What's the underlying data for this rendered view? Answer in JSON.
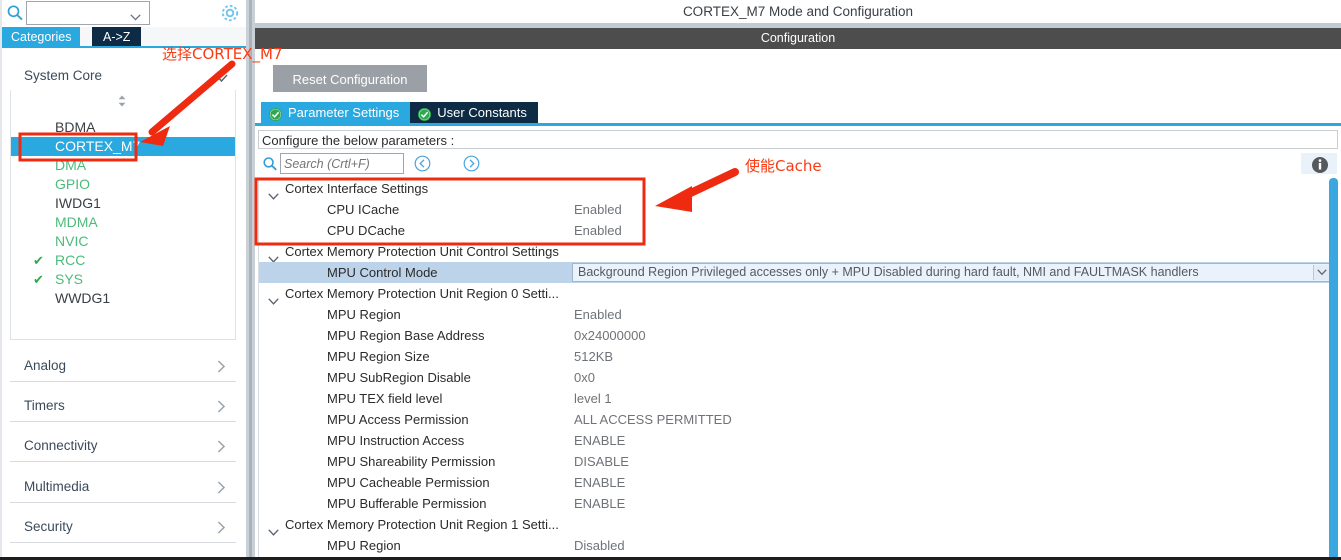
{
  "left": {
    "search": {
      "value": "",
      "placeholder": ""
    },
    "gear_icon": "gear-icon",
    "tabs": [
      {
        "id": "categories",
        "label": "Categories",
        "active": true
      },
      {
        "id": "a-to-z",
        "label": "A->Z",
        "active": false
      }
    ],
    "groups": [
      {
        "id": "system-core",
        "label": "System Core",
        "expanded": true
      },
      {
        "id": "analog",
        "label": "Analog",
        "expanded": false
      },
      {
        "id": "timers",
        "label": "Timers",
        "expanded": false
      },
      {
        "id": "connectivity",
        "label": "Connectivity",
        "expanded": false
      },
      {
        "id": "multimedia",
        "label": "Multimedia",
        "expanded": false
      },
      {
        "id": "security",
        "label": "Security",
        "expanded": false
      }
    ],
    "system_core_items": [
      {
        "label": "BDMA",
        "state": "dark",
        "check": false,
        "selected": false
      },
      {
        "label": "CORTEX_M7",
        "state": "sel",
        "check": false,
        "selected": true
      },
      {
        "label": "DMA",
        "state": "green",
        "check": false,
        "selected": false
      },
      {
        "label": "GPIO",
        "state": "green",
        "check": false,
        "selected": false
      },
      {
        "label": "IWDG1",
        "state": "dark",
        "check": false,
        "selected": false
      },
      {
        "label": "MDMA",
        "state": "green",
        "check": false,
        "selected": false
      },
      {
        "label": "NVIC",
        "state": "green",
        "check": false,
        "selected": false
      },
      {
        "label": "RCC",
        "state": "green",
        "check": true,
        "selected": false
      },
      {
        "label": "SYS",
        "state": "green",
        "check": true,
        "selected": false
      },
      {
        "label": "WWDG1",
        "state": "dark",
        "check": false,
        "selected": false
      }
    ]
  },
  "right": {
    "window_title": "CORTEX_M7 Mode and Configuration",
    "configuration_bar": "Configuration",
    "reset_button": "Reset Configuration",
    "tabs": [
      {
        "id": "parameter-settings",
        "label": "Parameter Settings",
        "active": true
      },
      {
        "id": "user-constants",
        "label": "User Constants",
        "active": false
      }
    ],
    "configure_note": "Configure the below parameters :",
    "search": {
      "value": "",
      "placeholder": "Search (Crtl+F)"
    },
    "nav_prev_icon": "circle-left-arrow-icon",
    "nav_next_icon": "circle-right-arrow-icon",
    "info_icon": "info-icon",
    "rows": [
      {
        "type": "group",
        "name": "Cortex Interface Settings",
        "value": "",
        "selected": false
      },
      {
        "type": "param",
        "name": "CPU ICache",
        "value": "Enabled",
        "selected": false
      },
      {
        "type": "param",
        "name": "CPU DCache",
        "value": "Enabled",
        "selected": false
      },
      {
        "type": "group",
        "name": "Cortex Memory Protection Unit Control Settings",
        "value": "",
        "selected": false
      },
      {
        "type": "combo",
        "name": "MPU Control Mode",
        "value": "Background Region Privileged accesses only + MPU Disabled during hard fault, NMI and FAULTMASK handlers",
        "selected": true
      },
      {
        "type": "group",
        "name": "Cortex Memory Protection Unit Region 0 Setti...",
        "value": "",
        "selected": false
      },
      {
        "type": "param",
        "name": "MPU Region",
        "value": "Enabled",
        "selected": false
      },
      {
        "type": "param",
        "name": "MPU Region Base Address",
        "value": "0x24000000",
        "selected": false
      },
      {
        "type": "param",
        "name": "MPU Region Size",
        "value": "512KB",
        "selected": false
      },
      {
        "type": "param",
        "name": "MPU SubRegion Disable",
        "value": "0x0",
        "selected": false
      },
      {
        "type": "param",
        "name": "MPU TEX field level",
        "value": "level 1",
        "selected": false
      },
      {
        "type": "param",
        "name": "MPU Access Permission",
        "value": "ALL ACCESS PERMITTED",
        "selected": false
      },
      {
        "type": "param",
        "name": "MPU Instruction Access",
        "value": "ENABLE",
        "selected": false
      },
      {
        "type": "param",
        "name": "MPU Shareability Permission",
        "value": "DISABLE",
        "selected": false
      },
      {
        "type": "param",
        "name": "MPU Cacheable Permission",
        "value": "ENABLE",
        "selected": false
      },
      {
        "type": "param",
        "name": "MPU Bufferable  Permission",
        "value": "ENABLE",
        "selected": false
      },
      {
        "type": "group",
        "name": "Cortex Memory Protection Unit Region 1 Setti...",
        "value": "",
        "selected": false
      },
      {
        "type": "param",
        "name": "MPU Region",
        "value": "Disabled",
        "selected": false
      }
    ]
  },
  "annotations": [
    {
      "id": "select-cortex",
      "text": "选择CORTEX_M7",
      "color": "#fb3b14"
    },
    {
      "id": "enable-cache",
      "text": "使能Cache",
      "color": "#fb3b14"
    }
  ],
  "colors": {
    "accent_blue": "#29a9e0",
    "tab_dark": "#0d2b45",
    "annotation_red": "#fb3b14",
    "green_peripheral": "#4dbb7a",
    "check_green": "#2fa84f",
    "config_bar": "#4d4d4d",
    "row_select": "#bcd3e9"
  }
}
